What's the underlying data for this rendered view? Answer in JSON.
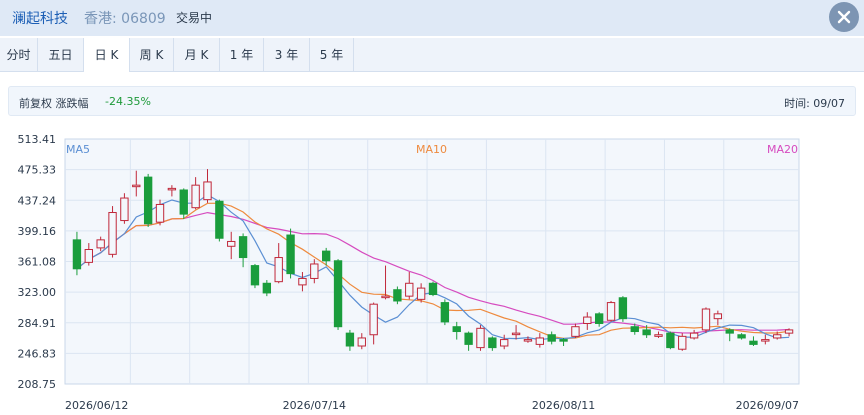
{
  "header": {
    "name": "澜起科技",
    "code": "香港: 06809",
    "status": "交易中",
    "close_icon": "close-icon"
  },
  "tabs": [
    {
      "label": "分时",
      "active": false
    },
    {
      "label": "五日",
      "active": false
    },
    {
      "label": "日 K",
      "active": true
    },
    {
      "label": "周 K",
      "active": false
    },
    {
      "label": "月 K",
      "active": false
    },
    {
      "label": "1 年",
      "active": false
    },
    {
      "label": "3 年",
      "active": false
    },
    {
      "label": "5 年",
      "active": false
    }
  ],
  "info": {
    "label": "前复权 涨跌幅",
    "change": "-24.35%",
    "time": "时间: 09/07"
  },
  "colors": {
    "up": "#c0283a",
    "down": "#1a9d3c",
    "ma5": "#5b8fd3",
    "ma10": "#ee8a3e",
    "ma20": "#d64bbf"
  },
  "chart_data": {
    "type": "candlestick",
    "ylim": [
      208.75,
      513.41
    ],
    "y_ticks": [
      "513.41",
      "475.33",
      "437.24",
      "399.16",
      "361.08",
      "323.00",
      "284.91",
      "246.83",
      "208.75"
    ],
    "x_ticks": [
      "2026/06/12",
      "2026/07/14",
      "2026/08/11",
      "2026/09/07"
    ],
    "ma_labels": {
      "ma5": "MA5",
      "ma10": "MA10",
      "ma20": "MA20"
    },
    "candles": [
      [
        388,
        352,
        398,
        344
      ],
      [
        360,
        376,
        384,
        356
      ],
      [
        378,
        388,
        392,
        374
      ],
      [
        370,
        422,
        430,
        366
      ],
      [
        412,
        440,
        446,
        408
      ],
      [
        456,
        456,
        474,
        442
      ],
      [
        466,
        408,
        470,
        404
      ],
      [
        410,
        432,
        438,
        406
      ],
      [
        452,
        452,
        456,
        442
      ],
      [
        450,
        420,
        452,
        414
      ],
      [
        428,
        456,
        466,
        426
      ],
      [
        438,
        460,
        476,
        434
      ],
      [
        436,
        390,
        438,
        386
      ],
      [
        380,
        386,
        398,
        364
      ],
      [
        392,
        366,
        396,
        354
      ],
      [
        356,
        332,
        358,
        328
      ],
      [
        334,
        322,
        338,
        318
      ],
      [
        336,
        366,
        384,
        334
      ],
      [
        394,
        346,
        402,
        340
      ],
      [
        332,
        340,
        348,
        324
      ],
      [
        340,
        358,
        364,
        334
      ],
      [
        374,
        362,
        378,
        356
      ],
      [
        362,
        280,
        364,
        276
      ],
      [
        272,
        256,
        276,
        250
      ],
      [
        256,
        266,
        272,
        252
      ],
      [
        270,
        308,
        310,
        258
      ],
      [
        318,
        318,
        356,
        314
      ],
      [
        326,
        312,
        330,
        308
      ],
      [
        318,
        334,
        348,
        314
      ],
      [
        314,
        328,
        334,
        310
      ],
      [
        334,
        320,
        336,
        318
      ],
      [
        310,
        286,
        314,
        282
      ],
      [
        280,
        274,
        286,
        264
      ],
      [
        272,
        258,
        274,
        250
      ],
      [
        254,
        278,
        282,
        250
      ],
      [
        266,
        254,
        268,
        250
      ],
      [
        256,
        264,
        270,
        252
      ],
      [
        272,
        272,
        282,
        264
      ],
      [
        264,
        264,
        268,
        260
      ],
      [
        258,
        266,
        272,
        254
      ],
      [
        270,
        262,
        274,
        258
      ],
      [
        264,
        262,
        266,
        256
      ],
      [
        268,
        280,
        284,
        266
      ],
      [
        284,
        292,
        298,
        276
      ],
      [
        296,
        284,
        298,
        280
      ],
      [
        288,
        310,
        312,
        286
      ],
      [
        316,
        290,
        318,
        286
      ],
      [
        280,
        274,
        284,
        270
      ],
      [
        276,
        270,
        282,
        266
      ],
      [
        268,
        270,
        274,
        266
      ],
      [
        272,
        254,
        274,
        252
      ],
      [
        252,
        268,
        272,
        250
      ],
      [
        266,
        272,
        276,
        264
      ],
      [
        276,
        302,
        304,
        272
      ],
      [
        290,
        296,
        300,
        282
      ],
      [
        276,
        272,
        278,
        262
      ],
      [
        270,
        266,
        272,
        264
      ],
      [
        262,
        258,
        268,
        256
      ],
      [
        264,
        264,
        270,
        258
      ],
      [
        266,
        270,
        274,
        264
      ],
      [
        272,
        276,
        278,
        268
      ]
    ]
  }
}
